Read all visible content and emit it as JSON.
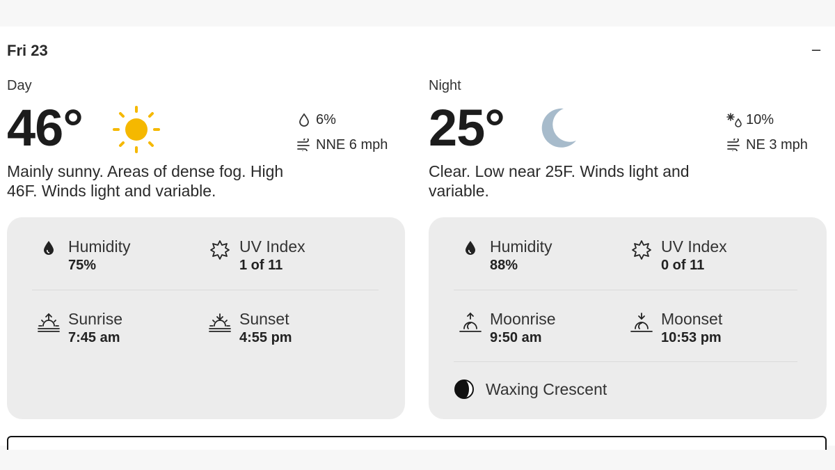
{
  "header": {
    "date": "Fri 23",
    "collapse_symbol": "–"
  },
  "day": {
    "label": "Day",
    "temperature": "46°",
    "condition_icon": "sun-icon",
    "precip_icon": "raindrop-icon",
    "precip": "6%",
    "wind_icon": "wind-icon",
    "wind": "NNE 6 mph",
    "narrative_line1": "Mainly sunny. Areas of dense fog. High",
    "narrative_line2": "46F. Winds light and variable.",
    "details": {
      "humidity_label": "Humidity",
      "humidity_value": "75%",
      "uv_label": "UV Index",
      "uv_value": "1 of 11",
      "rise_label": "Sunrise",
      "rise_value": "7:45 am",
      "set_label": "Sunset",
      "set_value": "4:55 pm"
    }
  },
  "night": {
    "label": "Night",
    "temperature": "25°",
    "condition_icon": "moon-icon",
    "precip_icon": "snowflake-drop-icon",
    "precip": "10%",
    "wind_icon": "wind-icon",
    "wind": "NE 3 mph",
    "narrative_line1": "Clear. Low near 25F. Winds light and",
    "narrative_line2": "variable.",
    "details": {
      "humidity_label": "Humidity",
      "humidity_value": "88%",
      "uv_label": "UV Index",
      "uv_value": "0 of 11",
      "rise_label": "Moonrise",
      "rise_value": "9:50 am",
      "set_label": "Moonset",
      "set_value": "10:53 pm",
      "moon_phase": "Waxing Crescent"
    }
  },
  "colors": {
    "sun": "#F5B800",
    "moon": "#A7BBCB",
    "panel": "#ECECEC",
    "text": "#1F1F1F"
  }
}
